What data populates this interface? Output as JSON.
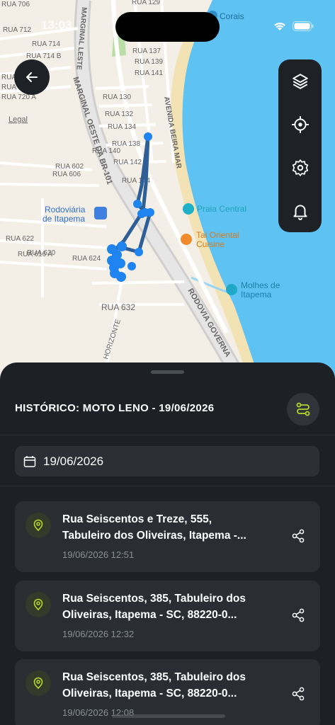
{
  "status": {
    "time": "13:03"
  },
  "map": {
    "labels": {
      "rua706": "RUA 706",
      "rua712": "RUA 712",
      "rua714": "RUA 714",
      "rua714b": "RUA 714 B",
      "rua716": "RUA 716",
      "rua720": "RUA 720",
      "rua720a": "RUA 720 A",
      "rua129": "RUA 129",
      "rua137": "RUA 137",
      "rua139": "RUA 139",
      "rua141": "RUA 141",
      "rua130": "RUA 130",
      "rua132": "RUA 132",
      "rua134": "RUA 134",
      "rua138": "RUA 138",
      "rua140": "RUA 140",
      "rua142": "RUA 142",
      "rua144": "RUA 144",
      "rua602": "RUA 602",
      "rua606": "RUA 606",
      "rua622": "RUA 622",
      "rua620": "RUA 620",
      "rua616a": "RUA 616 A",
      "rua624": "RUA 624",
      "rua632": "RUA 632",
      "legal": "Legal",
      "marginal_leste": "MARGINAL LESTE",
      "marginal_oeste": "MARGINAL OESTE DA BR-101",
      "avenida": "AVENIDA BEIRA MAR",
      "rodovia": "RODOVIA GOVERNA",
      "horizonte": "HORIZONTE",
      "rodoviaria_1": "Rodoviária",
      "rodoviaria_2": "de Itapema",
      "praia": "Praia Central",
      "tai_1": "Tai Oriental",
      "tai_2": "Cuisine",
      "molhes_1": "Molhes de",
      "molhes_2": "Itapema",
      "corais": "Corais"
    },
    "colors": {
      "land": "#f4efe6",
      "water": "#5ec3f2",
      "sand": "#f3e3b4",
      "route": "#2e5f96",
      "point": "#1f83f0"
    }
  },
  "sheet": {
    "title": "HISTÓRICO: MOTO LENO - 19/06/2026",
    "date_value": "19/06/2026",
    "entries": [
      {
        "line1": "Rua Seiscentos e Treze, 555,",
        "line2": "Tabuleiro dos Oliveiras, Itapema -...",
        "time": "19/06/2026 12:51"
      },
      {
        "line1": "Rua Seiscentos, 385, Tabuleiro dos",
        "line2": "Oliveiras, Itapema - SC, 88220-0...",
        "time": "19/06/2026 12:32"
      },
      {
        "line1": "Rua Seiscentos, 385, Tabuleiro dos",
        "line2": "Oliveiras, Itapema - SC, 88220-0...",
        "time": "19/06/2026 12:08"
      }
    ]
  }
}
